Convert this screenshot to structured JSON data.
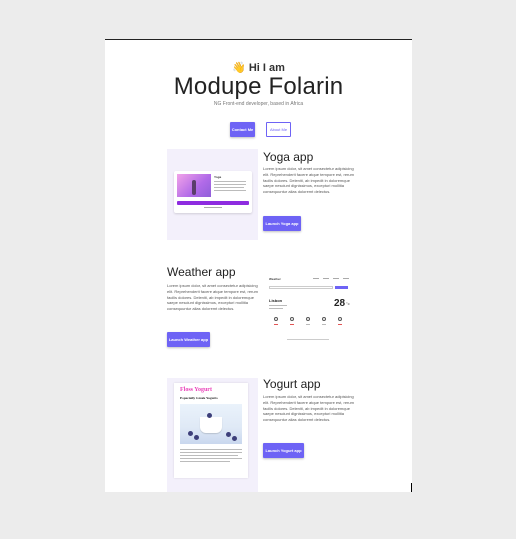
{
  "hero": {
    "wave_icon": "👋",
    "greeting": "Hi I am",
    "name": "Modupe Folarin",
    "subtitle": "NG Front-end developer, based in Africa",
    "contact_label": "Contact Me",
    "about_label": "About Me"
  },
  "projects": [
    {
      "title": "Yoga app",
      "description": "Lorem ipsum dolor, sit amet consectetur adipisicing elit. Reprehenderit facere atque tempore est, rerum facilis dolores. Deleniti, ab impedit in doloremque saepe nesciunt dignissimos, excepturi mollitia consequuntur alias doloremt delectus.",
      "button_label": "Launch Yoga app",
      "preview": {
        "heading": "Yoga"
      }
    },
    {
      "title": "Weather app",
      "description": "Lorem ipsum dolor, sit amet consectetur adipisicing elit. Reprehenderit facere atque tempore est, rerum facilis dolores. Deleniti, ab impedit in doloremque saepe nesciunt dignissimos, excepturi mollitia consequuntur alias doloremt delectus.",
      "button_label": "Launch Weather app",
      "preview": {
        "logo": "Weather",
        "city": "Lisbon",
        "temp": "28",
        "unit": "°c"
      }
    },
    {
      "title": "Yogurt app",
      "description": "Lorem ipsum dolor, sit amet consectetur adipisicing elit. Reprehenderit facere atque tempore est, rerum facilis dolores. Deleniti, ab impedit in doloremque saepe nesciunt dignissimos, excepturi mollitia consequuntur alias doloremt delectus.",
      "button_label": "Launch Yogurt app",
      "preview": {
        "brand": "Floss Yogurt",
        "tagline": "Especially Greek Yogurts"
      }
    }
  ],
  "colors": {
    "accent": "#6e63f5",
    "thumb_bg": "#f3f0fb",
    "yogurt_brand": "#e93fb8"
  }
}
